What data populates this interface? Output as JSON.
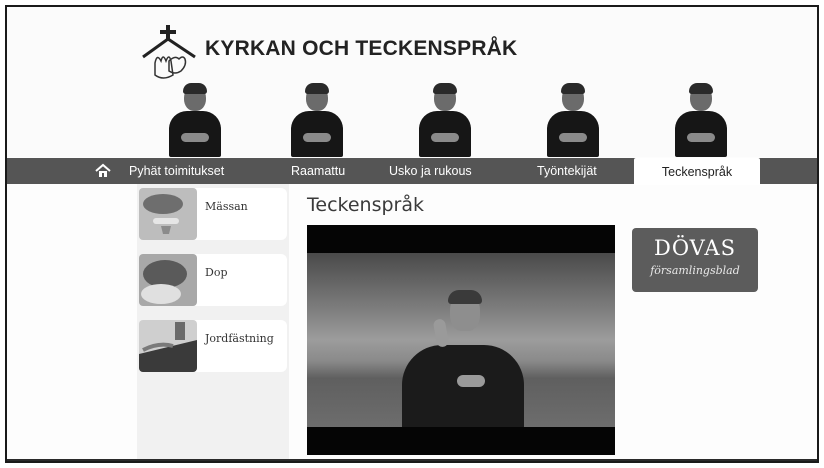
{
  "header": {
    "site_title": "KYRKAN OCH TECKENSPRÅK",
    "logo_icon": "church-signing-hands-icon"
  },
  "nav": {
    "home_icon": "home-icon",
    "items": [
      {
        "label": "Pyhät toimitukset",
        "active": false
      },
      {
        "label": "Raamattu",
        "active": false
      },
      {
        "label": "Usko ja rukous",
        "active": false
      },
      {
        "label": "Työntekijät",
        "active": false
      },
      {
        "label": "Teckenspråk",
        "active": true
      }
    ]
  },
  "sidebar": {
    "items": [
      {
        "label": "Mässan"
      },
      {
        "label": "Dop"
      },
      {
        "label": "Jordfästning"
      }
    ]
  },
  "main": {
    "title": "Teckenspråk"
  },
  "promo": {
    "title": "DÖVAS",
    "subtitle": "församlingsblad"
  },
  "colors": {
    "nav_bg": "#555555",
    "sidebar_bg": "#f1f1f1",
    "promo_bg": "#5c5c5c"
  }
}
